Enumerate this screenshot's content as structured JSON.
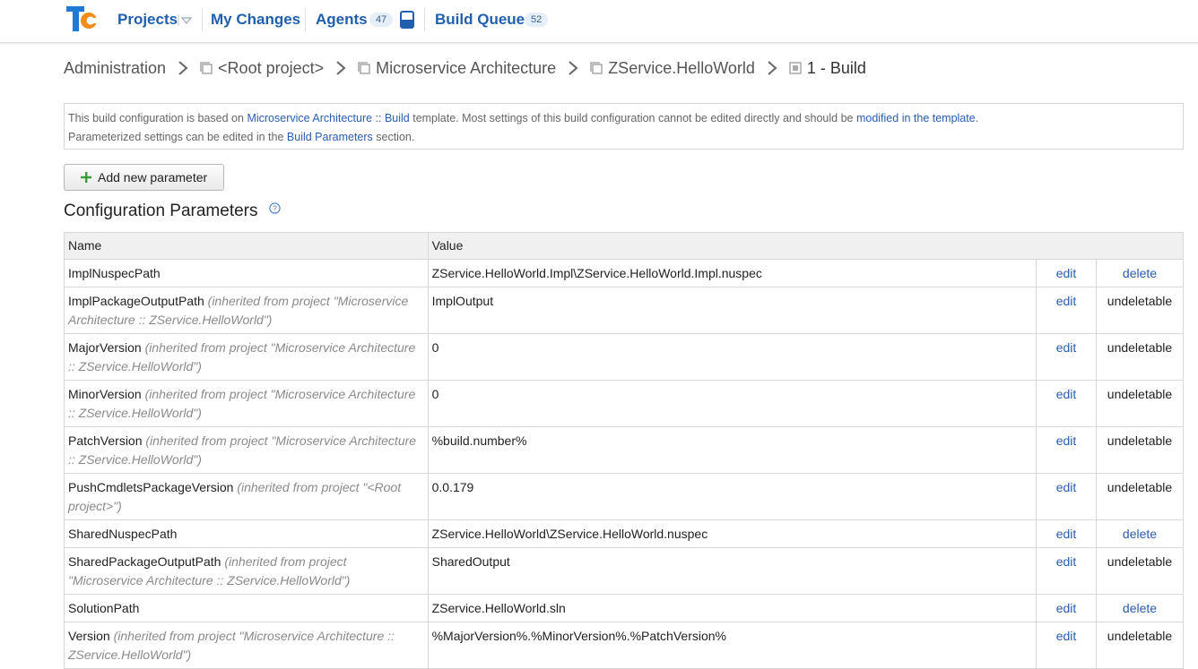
{
  "header": {
    "projects_label": "Projects",
    "my_changes_label": "My Changes",
    "agents_label": "Agents",
    "agents_count": "47",
    "build_queue_label": "Build Queue",
    "build_queue_count": "52",
    "logo_text": "TC"
  },
  "breadcrumb": {
    "items": [
      "Administration",
      "<Root project>",
      "Microservice Architecture",
      "ZService.HelloWorld",
      "1 - Build"
    ]
  },
  "info": {
    "line1_a": "This build configuration is based on ",
    "line1_link": "Microservice Architecture :: Build",
    "line1_b": " template. Most settings of this build configuration cannot be edited directly and should be ",
    "line1_link2": "modified in the template",
    "line1_c": ".",
    "line2_a": "Parameterized settings can be edited in the ",
    "line2_link": "Build Parameters",
    "line2_b": " section."
  },
  "add_button_label": "Add new parameter",
  "section_title": "Configuration Parameters",
  "table": {
    "headers": {
      "name": "Name",
      "value": "Value"
    },
    "rows": [
      {
        "name": "ImplNuspecPath",
        "inherited": "",
        "value": "ZService.HelloWorld.Impl\\ZService.HelloWorld.Impl.nuspec",
        "edit": "edit",
        "action": "delete",
        "deletable": true
      },
      {
        "name": "ImplPackageOutputPath",
        "inherited": "(inherited from project \"Microservice Architecture :: ZService.HelloWorld\")",
        "value": "ImplOutput",
        "edit": "edit",
        "action": "undeletable",
        "deletable": false
      },
      {
        "name": "MajorVersion",
        "inherited": "(inherited from project \"Microservice Architecture :: ZService.HelloWorld\")",
        "value": "0",
        "edit": "edit",
        "action": "undeletable",
        "deletable": false
      },
      {
        "name": "MinorVersion",
        "inherited": "(inherited from project \"Microservice Architecture :: ZService.HelloWorld\")",
        "value": "0",
        "edit": "edit",
        "action": "undeletable",
        "deletable": false
      },
      {
        "name": "PatchVersion",
        "inherited": "(inherited from project \"Microservice Architecture :: ZService.HelloWorld\")",
        "value": "%build.number%",
        "edit": "edit",
        "action": "undeletable",
        "deletable": false
      },
      {
        "name": "PushCmdletsPackageVersion",
        "inherited": "(inherited from project \"<Root project>\")",
        "value": "0.0.179",
        "edit": "edit",
        "action": "undeletable",
        "deletable": false
      },
      {
        "name": "SharedNuspecPath",
        "inherited": "",
        "value": "ZService.HelloWorld\\ZService.HelloWorld.nuspec",
        "edit": "edit",
        "action": "delete",
        "deletable": true
      },
      {
        "name": "SharedPackageOutputPath",
        "inherited": "(inherited from project \"Microservice Architecture :: ZService.HelloWorld\")",
        "value": "SharedOutput",
        "edit": "edit",
        "action": "undeletable",
        "deletable": false
      },
      {
        "name": "SolutionPath",
        "inherited": "",
        "value": "ZService.HelloWorld.sln",
        "edit": "edit",
        "action": "delete",
        "deletable": true
      },
      {
        "name": "Version",
        "inherited": "(inherited from project \"Microservice Architecture :: ZService.HelloWorld\")",
        "value": "%MajorVersion%.%MinorVersion%.%PatchVersion%",
        "edit": "edit",
        "action": "undeletable",
        "deletable": false
      }
    ]
  },
  "colors": {
    "link": "#2a5db0",
    "nav": "#1f5fae",
    "inherited": "#8a8a8a",
    "header_bg": "#f0f0f0",
    "logo_blue": "#1e7ad6",
    "logo_orange": "#f28c1a"
  }
}
